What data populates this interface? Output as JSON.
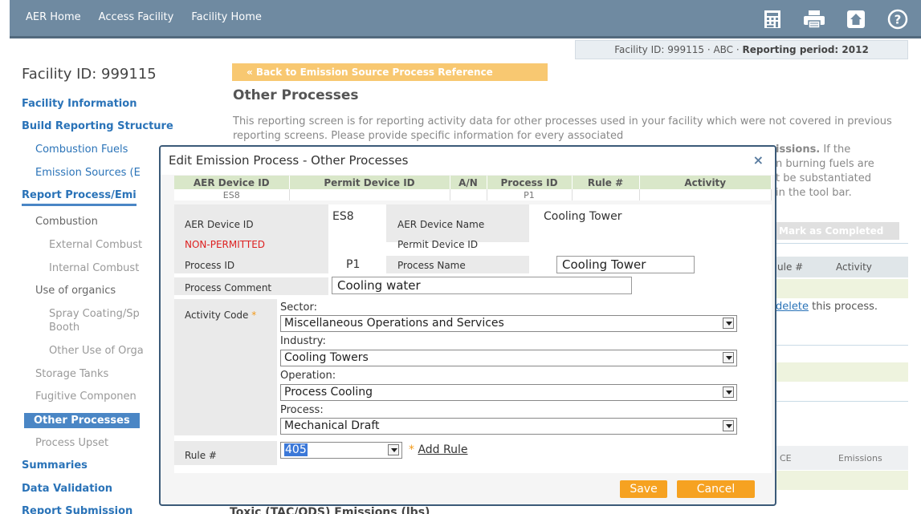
{
  "topnav": {
    "aer_home": "AER Home",
    "access_facility": "Access Facility",
    "facility_home": "Facility Home"
  },
  "facility_bar": {
    "prefix": "Facility ID: 999115 · ABC · ",
    "period": "Reporting period: 2012"
  },
  "sidebar": {
    "title": "Facility ID: 999115",
    "facility_information": "Facility Information",
    "build_reporting_structure": "Build Reporting Structure",
    "combustion_fuels": "Combustion Fuels",
    "emission_sources": "Emission Sources (E",
    "report_process": "Report Process/Emi",
    "combustion": "Combustion",
    "external_combustion": "External Combust",
    "internal_combustion": "Internal Combust",
    "use_of_organics": "Use of organics",
    "spray_coating": "Spray Coating/Sp",
    "booth": "Booth",
    "other_use_of_organics": "Other Use of Orga",
    "storage_tanks": "Storage Tanks",
    "fugitive_components": "Fugitive Componen",
    "other_processes": "Other Processes",
    "process_upset": "Process Upset",
    "summaries": "Summaries",
    "data_validation": "Data Validation",
    "report_submission": "Report Submission"
  },
  "main": {
    "back_button": "« Back to Emission Source Process Reference",
    "title": "Other Processes",
    "intro": "This reporting screen is for reporting activity data for other processes used in your facility which were not covered in previous reporting screens. Please provide specific information for every associated",
    "intro_r1_bold": "issions.",
    "intro_r1_rest": " If the",
    "intro_r2": "n burning fuels are",
    "intro_r3": "t be substantiated",
    "intro_r4": "in the tool bar.",
    "mark_completed": "Mark as Completed",
    "col_rule": "ule #",
    "col_activity": "Activity",
    "delete_link": "delete",
    "delete_rest": " this process.",
    "col_ce": "CE",
    "col_emissions": "Emissions",
    "bottom_heading": "Toxic (TAC/ODS) Emissions (lbs)"
  },
  "modal": {
    "title": "Edit Emission Process - Other Processes",
    "close": "×",
    "table_headers": [
      "AER Device ID",
      "Permit Device ID",
      "A/N",
      "Process ID",
      "Rule #",
      "Activity"
    ],
    "table_row": [
      "ES8",
      "",
      "",
      "P1",
      "",
      ""
    ],
    "aer_device_id_label": "AER Device ID",
    "aer_device_id": "ES8",
    "aer_device_name_label": "AER Device Name",
    "aer_device_name": "Cooling Tower",
    "non_permitted": "NON-PERMITTED",
    "permit_device_id_label": "Permit Device ID",
    "process_id_label": "Process ID",
    "process_id": "P1",
    "process_name_label": "Process Name",
    "process_name": "Cooling Tower",
    "process_comment_label": "Process Comment",
    "process_comment": "Cooling water",
    "activity_code_label": "Activity Code",
    "required_star": "*",
    "sector_label": "Sector:",
    "sector": "Miscellaneous Operations and Services",
    "industry_label": "Industry:",
    "industry": "Cooling Towers",
    "operation_label": "Operation:",
    "operation": "Process Cooling",
    "process_label": "Process:",
    "process": "Mechanical Draft",
    "rule_label": "Rule #",
    "rule": "405",
    "add_rule": "Add Rule",
    "save": "Save",
    "cancel": "Cancel"
  }
}
